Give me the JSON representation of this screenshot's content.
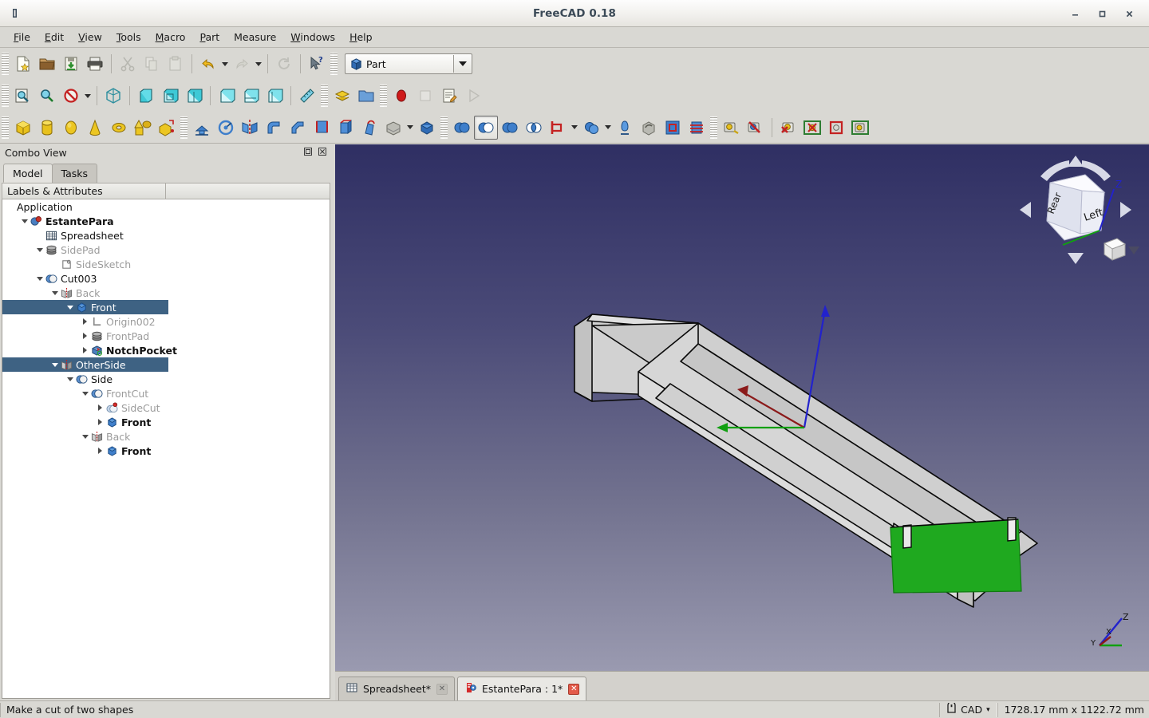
{
  "window": {
    "title": "FreeCAD 0.18",
    "app_icon": "freecad-app-icon",
    "minimize_label": "–",
    "maximize_label": "☐",
    "close_label": "✕"
  },
  "menubar": {
    "items": [
      {
        "label": "File",
        "mnemonic": "F"
      },
      {
        "label": "Edit",
        "mnemonic": "E"
      },
      {
        "label": "View",
        "mnemonic": "V"
      },
      {
        "label": "Tools",
        "mnemonic": "T"
      },
      {
        "label": "Macro",
        "mnemonic": "M"
      },
      {
        "label": "Part",
        "mnemonic": "P"
      },
      {
        "label": "Measure",
        "mnemonic": ""
      },
      {
        "label": "Windows",
        "mnemonic": "W"
      },
      {
        "label": "Help",
        "mnemonic": "H"
      }
    ]
  },
  "toolbars": {
    "file": [
      {
        "name": "new-document-icon",
        "title": "New"
      },
      {
        "name": "open-document-icon",
        "title": "Open"
      },
      {
        "name": "save-document-icon",
        "title": "Save"
      },
      {
        "name": "print-icon",
        "title": "Print"
      },
      {
        "name": "cut-icon",
        "title": "Cut",
        "disabled": true
      },
      {
        "name": "copy-icon",
        "title": "Copy",
        "disabled": true
      },
      {
        "name": "paste-icon",
        "title": "Paste",
        "disabled": true
      },
      {
        "name": "undo-icon",
        "title": "Undo"
      },
      {
        "name": "redo-icon",
        "title": "Redo",
        "disabled": true
      },
      {
        "name": "refresh-icon",
        "title": "Refresh",
        "disabled": true
      },
      {
        "name": "whats-this-icon",
        "title": "What's This"
      }
    ],
    "workbench": {
      "label": "Part",
      "icon": "part-workbench-icon"
    },
    "view": [
      {
        "name": "fit-all-icon",
        "title": "Fit All"
      },
      {
        "name": "fit-selection-icon",
        "title": "Fit Selection"
      },
      {
        "name": "draw-style-icon",
        "title": "Draw Style"
      },
      {
        "name": "axonometric-view-icon",
        "title": "Axonometric"
      },
      {
        "name": "front-view-icon",
        "title": "Front"
      },
      {
        "name": "top-view-icon",
        "title": "Top"
      },
      {
        "name": "right-view-icon",
        "title": "Right"
      },
      {
        "name": "rear-view-icon",
        "title": "Rear"
      },
      {
        "name": "bottom-view-icon",
        "title": "Bottom"
      },
      {
        "name": "left-view-icon",
        "title": "Left"
      },
      {
        "name": "measure-icon",
        "title": "Measure"
      },
      {
        "name": "workbench-structure-icon",
        "title": "Create part"
      },
      {
        "name": "create-group-icon",
        "title": "Create group"
      },
      {
        "name": "macro-record-icon",
        "title": "Macro recording"
      },
      {
        "name": "macro-stop-icon",
        "title": "Stop recording",
        "disabled": true
      },
      {
        "name": "macro-edit-icon",
        "title": "Macros"
      },
      {
        "name": "macro-execute-icon",
        "title": "Execute macro",
        "disabled": true
      }
    ],
    "primitives": [
      {
        "name": "box-icon",
        "title": "Cube"
      },
      {
        "name": "cylinder-icon",
        "title": "Cylinder"
      },
      {
        "name": "sphere-icon",
        "title": "Sphere"
      },
      {
        "name": "cone-icon",
        "title": "Cone"
      },
      {
        "name": "torus-icon",
        "title": "Torus"
      },
      {
        "name": "primitives-icon",
        "title": "Create primitives"
      },
      {
        "name": "shape-builder-icon",
        "title": "Shape builder"
      }
    ],
    "modelling": [
      {
        "name": "extrude-icon",
        "title": "Extrude"
      },
      {
        "name": "revolve-icon",
        "title": "Revolve"
      },
      {
        "name": "mirror-icon",
        "title": "Mirroring"
      },
      {
        "name": "fillet-icon",
        "title": "Fillet"
      },
      {
        "name": "chamfer-icon",
        "title": "Chamfer"
      },
      {
        "name": "ruled-surface-icon",
        "title": "Ruled Surface"
      },
      {
        "name": "loft-icon",
        "title": "Loft"
      },
      {
        "name": "sweep-icon",
        "title": "Sweep"
      },
      {
        "name": "section-icon",
        "title": "Section"
      },
      {
        "name": "offset-icon",
        "title": "3D Offset"
      },
      {
        "name": "thickness-icon",
        "title": "Thickness"
      }
    ],
    "boolean": [
      {
        "name": "boolean-icon",
        "title": "Boolean"
      },
      {
        "name": "cut-shapes-icon",
        "title": "Cut",
        "pressed": true
      },
      {
        "name": "union-icon",
        "title": "Union"
      },
      {
        "name": "common-icon",
        "title": "Intersection"
      },
      {
        "name": "join-connect-icon",
        "title": "Join objects"
      },
      {
        "name": "split-icon",
        "title": "Split objects"
      },
      {
        "name": "compound-tools-icon",
        "title": "Compound tools"
      },
      {
        "name": "check-geometry-icon",
        "title": "Check geometry"
      },
      {
        "name": "defeaturing-icon",
        "title": "Defeaturing"
      },
      {
        "name": "cross-sections-icon",
        "title": "Cross-sections"
      }
    ],
    "structure": [
      {
        "name": "std-view-group-icon",
        "title": "View group"
      },
      {
        "name": "std-view-group-off-icon",
        "title": "View group off"
      },
      {
        "name": "view-hide-icon",
        "title": "Hide"
      },
      {
        "name": "view-box-show-icon",
        "title": "Show box"
      },
      {
        "name": "view-box-hide-icon",
        "title": "Hide box"
      },
      {
        "name": "view-select-icon",
        "title": "Select view"
      }
    ]
  },
  "combo_view": {
    "title": "Combo View",
    "float_button": "float-icon",
    "close_button": "close-icon",
    "tabs": [
      {
        "label": "Model",
        "active": true
      },
      {
        "label": "Tasks",
        "active": false
      }
    ],
    "tree_header": "Labels & Attributes"
  },
  "tree": {
    "items": [
      {
        "label": "Application",
        "depth": 0,
        "twist": "none",
        "icon": "",
        "selected": false,
        "dim": false,
        "bold": false
      },
      {
        "label": "EstantePara",
        "depth": 1,
        "twist": "open",
        "icon": "document-icon",
        "selected": false,
        "dim": false,
        "bold": true
      },
      {
        "label": "Spreadsheet",
        "depth": 2,
        "twist": "none",
        "icon": "spreadsheet-icon",
        "selected": false,
        "dim": false,
        "bold": false
      },
      {
        "label": "SidePad",
        "depth": 2,
        "twist": "open",
        "icon": "pad-icon",
        "selected": false,
        "dim": true,
        "bold": false
      },
      {
        "label": "SideSketch",
        "depth": 3,
        "twist": "none",
        "icon": "sketch-icon",
        "selected": false,
        "dim": true,
        "bold": false
      },
      {
        "label": "Cut003",
        "depth": 2,
        "twist": "open",
        "icon": "cut-boolean-icon",
        "selected": false,
        "dim": false,
        "bold": false
      },
      {
        "label": "Back",
        "depth": 3,
        "twist": "open",
        "icon": "mirror-icon",
        "selected": false,
        "dim": true,
        "bold": false
      },
      {
        "label": "Front",
        "depth": 4,
        "twist": "open",
        "icon": "body-icon",
        "selected": true,
        "dim": false,
        "bold": false
      },
      {
        "label": "Origin002",
        "depth": 5,
        "twist": "closed",
        "icon": "origin-icon",
        "selected": false,
        "dim": true,
        "bold": false
      },
      {
        "label": "FrontPad",
        "depth": 5,
        "twist": "closed",
        "icon": "pad-icon",
        "selected": false,
        "dim": true,
        "bold": false
      },
      {
        "label": "NotchPocket",
        "depth": 5,
        "twist": "closed",
        "icon": "pocket-icon",
        "selected": false,
        "dim": false,
        "bold": true
      },
      {
        "label": "OtherSide",
        "depth": 3,
        "twist": "open",
        "icon": "mirror-icon",
        "selected": true,
        "dim": false,
        "bold": false
      },
      {
        "label": "Side",
        "depth": 4,
        "twist": "open",
        "icon": "cut-boolean-icon",
        "selected": false,
        "dim": false,
        "bold": false
      },
      {
        "label": "FrontCut",
        "depth": 5,
        "twist": "open",
        "icon": "cut-boolean-icon",
        "selected": false,
        "dim": true,
        "bold": false
      },
      {
        "label": "SideCut",
        "depth": 6,
        "twist": "closed",
        "icon": "cut-error-icon",
        "selected": false,
        "dim": true,
        "bold": false
      },
      {
        "label": "Front",
        "depth": 6,
        "twist": "closed",
        "icon": "body-icon",
        "selected": false,
        "dim": false,
        "bold": true
      },
      {
        "label": "Back",
        "depth": 5,
        "twist": "open",
        "icon": "mirror-icon",
        "selected": false,
        "dim": true,
        "bold": false
      },
      {
        "label": "Front",
        "depth": 6,
        "twist": "closed",
        "icon": "body-icon",
        "selected": false,
        "dim": false,
        "bold": true
      }
    ]
  },
  "viewport": {
    "nav_cube": {
      "face_left_label": "Left",
      "face_rear_label": "Rear",
      "z_axis_label": "Z",
      "corner_button": "home-view-icon",
      "menu_button": "nav-menu-icon"
    },
    "axis_cross": {
      "x": "X",
      "y": "Y",
      "z": "Z"
    },
    "background_top_color": "#2f2f63",
    "background_bottom_color": "#9a9ab0",
    "shape_face_color": "#d2d2d2",
    "selected_face_color": "#1fa91f",
    "axis_x_color": "#8b1a1a",
    "axis_y_color": "#11a011",
    "axis_z_color": "#2222cc"
  },
  "mdi_tabs": [
    {
      "label": "Spreadsheet*",
      "icon": "spreadsheet-icon",
      "active": false,
      "close": "✕"
    },
    {
      "label": "EstantePara : 1*",
      "icon": "freecad-doc-icon",
      "active": true,
      "close": "✕"
    }
  ],
  "statusbar": {
    "message": "Make a cut of two shapes",
    "unit_system": "CAD",
    "unit_caret": "▾",
    "dimensions": "1728.17 mm x 1122.72 mm",
    "dimension_icon": "dimension-icon"
  }
}
